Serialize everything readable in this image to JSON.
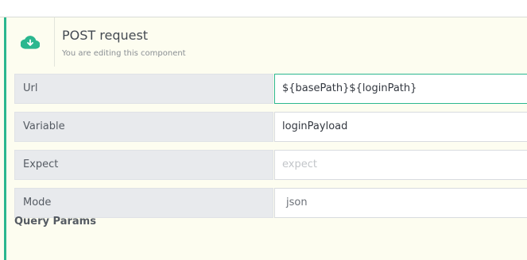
{
  "component": {
    "title": "POST request",
    "subtitle": "You are editing this component",
    "icon": "cloud-download-icon",
    "accent_color": "#2bb78f"
  },
  "fields": [
    {
      "label": "Url",
      "value": "${basePath}${loginPath}",
      "placeholder": ""
    },
    {
      "label": "Variable",
      "value": "loginPayload",
      "placeholder": ""
    },
    {
      "label": "Expect",
      "value": "",
      "placeholder": "expect"
    },
    {
      "label": "Mode",
      "value": "json",
      "placeholder": ""
    }
  ],
  "sections": {
    "query_params": "Query Params"
  }
}
